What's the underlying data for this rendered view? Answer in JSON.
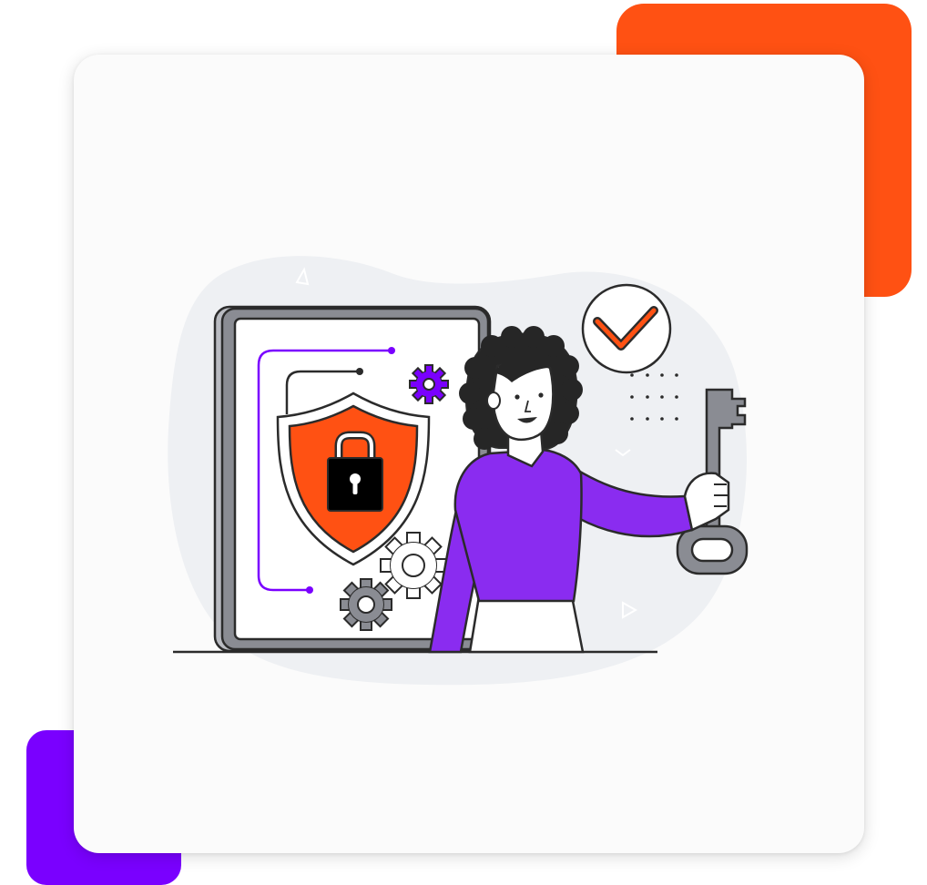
{
  "colors": {
    "orange": "#ff5113",
    "purple": "#7a00ff",
    "card": "#fbfbfb",
    "blob": "#eef0f3",
    "outline": "#2b2b2b",
    "gray": "#8a8c93",
    "shirt": "#8a2cf0",
    "skin": "#ffffff",
    "hair": "#262626"
  },
  "icons": [
    "shield-icon",
    "padlock-icon",
    "gear-icon",
    "key-icon",
    "checkmark-icon"
  ]
}
